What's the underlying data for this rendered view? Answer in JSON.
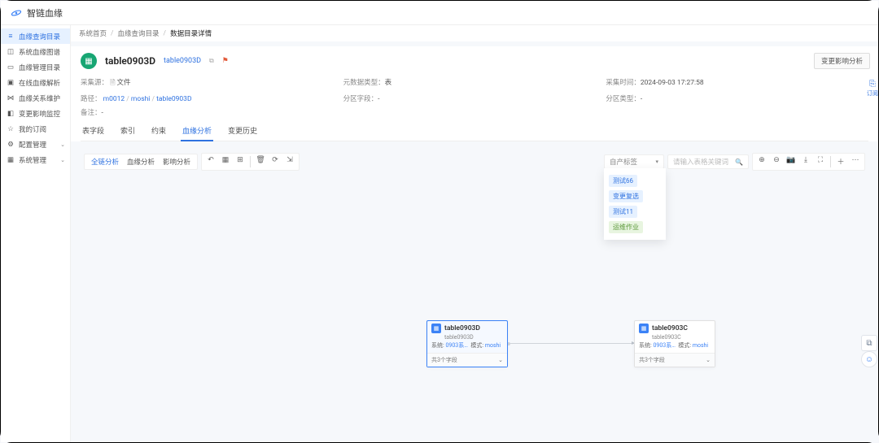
{
  "app_name": "智链血缘",
  "breadcrumb": {
    "a": "系统首页",
    "b": "血缘查询目录",
    "c": "数据目录详情"
  },
  "sidebar": {
    "items": [
      {
        "label": "血缘查询目录"
      },
      {
        "label": "系统血缘图谱"
      },
      {
        "label": "血缘管理目录"
      },
      {
        "label": "在线血缘解析"
      },
      {
        "label": "血缘关系维护"
      },
      {
        "label": "变更影响监控"
      },
      {
        "label": "我的订阅"
      },
      {
        "label": "配置管理"
      },
      {
        "label": "系统管理"
      }
    ]
  },
  "header": {
    "title": "table0903D",
    "link": "table0903D",
    "change_btn": "变更影响分析",
    "toggle_text": "订阅",
    "meta": {
      "r1c1_l": "采集源：",
      "r1c1_v": "文件",
      "r1c2_l": "元数据类型：",
      "r1c2_v": "表",
      "r1c3_l": "采集时间：",
      "r1c3_v": "2024-09-03 17:27:58",
      "r2c1_l": "路径：",
      "r2c1_a": "m0012",
      "r2c1_b": "moshi",
      "r2c1_c": "table0903D",
      "r2c2_l": "分区字段：",
      "r2c2_v": "-",
      "r2c3_l": "分区类型：",
      "r2c3_v": "-",
      "r3c1_l": "备注：",
      "r3c1_v": "-"
    }
  },
  "tabs": {
    "t1": "表字段",
    "t2": "索引",
    "t3": "约束",
    "t4": "血缘分析",
    "t5": "变更历史"
  },
  "canvas": {
    "seg1": "全链分析",
    "seg2": "血缘分析",
    "seg3": "影响分析",
    "dropdown_label": "自产标签",
    "search_placeholder": "请输入表格关键词",
    "dd_opts": {
      "o1": "测试66",
      "o2": "变更复选",
      "o3": "测试11",
      "o4": "运维作业"
    },
    "nodeA": {
      "title": "table0903D",
      "sub": "table0903D",
      "sys_l": "系统:",
      "sys_v": "0903系…",
      "mode_l": "模式:",
      "mode_v": "moshi",
      "footer": "共3个字段"
    },
    "nodeB": {
      "title": "table0903C",
      "sub": "table0903C",
      "sys_l": "系统:",
      "sys_v": "0903系…",
      "mode_l": "模式:",
      "mode_v": "moshi",
      "footer": "共3个字段"
    }
  }
}
